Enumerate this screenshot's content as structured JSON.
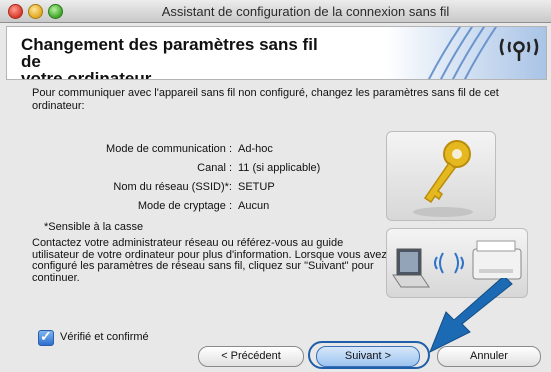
{
  "window": {
    "title": "Assistant de configuration de la connexion sans fil"
  },
  "header": {
    "title_line1": "Changement des paramètres sans fil de",
    "title_line2": "votre ordinateur"
  },
  "intro": "Pour communiquer avec l'appareil sans fil non configuré, changez les paramètres sans fil de cet ordinateur:",
  "params": [
    {
      "label": "Mode de communication :",
      "value": "Ad-hoc"
    },
    {
      "label": "Canal :",
      "value": "11  (si applicable)"
    },
    {
      "label": "Nom du réseau (SSID)*:",
      "value": "SETUP"
    },
    {
      "label": "Mode de cryptage :",
      "value": "Aucun"
    }
  ],
  "note": "*Sensible à la casse",
  "paragraph": "Contactez votre administrateur réseau ou référez-vous au guide utilisateur de votre ordinateur pour plus d'information. Lorsque vous avez configuré les paramètres de réseau sans fil, cliquez sur \"Suivant\" pour continuer.",
  "checkbox": {
    "label": "Vérifié et confirmé",
    "checked": true
  },
  "buttons": {
    "prev": "< Précédent",
    "next": "Suivant >",
    "cancel": "Annuler"
  },
  "colors": {
    "accent": "#1f5ea8",
    "arrow": "#1c6ab3",
    "key": "#e6b81f"
  }
}
